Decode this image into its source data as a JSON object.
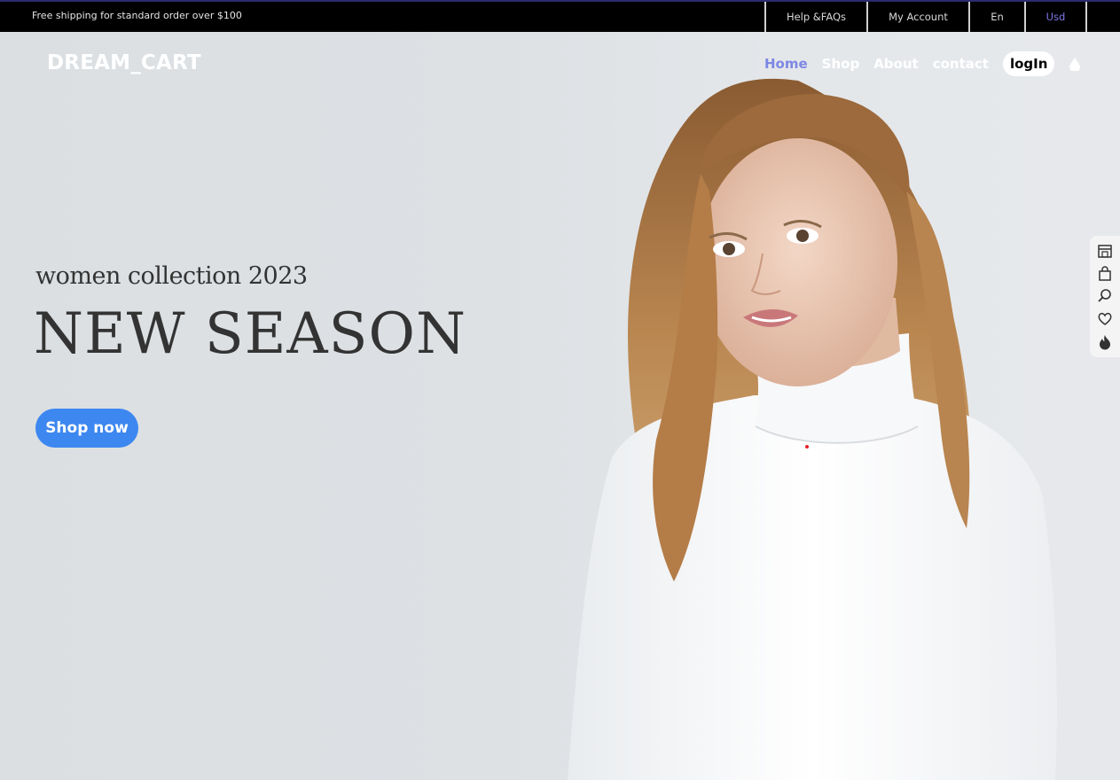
{
  "topbar": {
    "promo": "Free shipping for standard order over $100",
    "links": [
      "Help &FAQs",
      "My Account",
      "En",
      "Usd"
    ]
  },
  "header": {
    "logo": "DREAM_CART",
    "nav": [
      "Home",
      "Shop",
      "About",
      "contact"
    ],
    "login": "logIn",
    "active_color": "#7d88e3"
  },
  "hero": {
    "subtitle": "women collection 2023",
    "headline": "NEW SEASON",
    "cta": "Shop now",
    "cta_color": "#3d87f0"
  },
  "sidebar": {
    "icons": [
      "store-icon",
      "shopping-bag-icon",
      "search-icon",
      "heart-icon",
      "flame-icon"
    ]
  }
}
